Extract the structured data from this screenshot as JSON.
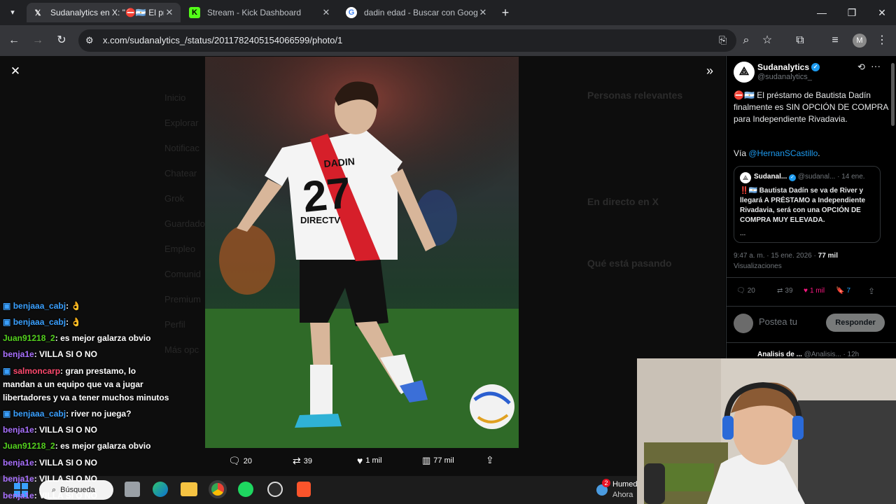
{
  "browser": {
    "tabs": [
      {
        "label": "Sudanalytics en X: \"⛔🇦🇷 El pré",
        "icon": "x-logo-icon"
      },
      {
        "label": "Stream - Kick Dashboard",
        "icon": "kick-logo-icon"
      },
      {
        "label": "dadin edad - Buscar con Google",
        "icon": "google-logo-icon"
      }
    ],
    "url": "x.com/sudanalytics_/status/2011782405154066599/photo/1",
    "profile_initial": "M"
  },
  "photo": {
    "alt": "River Plate player number 27 Dadín",
    "jersey_name": "DADIN",
    "jersey_number": "27",
    "sponsor": "DIRECTV"
  },
  "photo_actions": {
    "replies": "20",
    "reposts": "39",
    "likes": "1 mil",
    "views": "77 mil"
  },
  "tweet": {
    "author_name": "Sudanalytics",
    "author_handle": "@sudanalytics_",
    "text": "⛔🇦🇷 El préstamo de Bautista Dadín finalmente es SIN OPCIÓN DE COMPRA para Independiente Rivadavia.",
    "via_prefix": "Vía ",
    "via_mention": "@HernanSCastillo",
    "via_suffix": ".",
    "quote": {
      "author": "Sudanal...",
      "handle": "@sudanal...",
      "date": "· 14 ene.",
      "text": "‼️🇦🇷 Bautista Dadín se va de River y llegará A PRÉSTAMO a Independiente Rivadavia, será con una OPCIÓN DE COMPRA MUY ELEVADA.",
      "more": "..."
    },
    "timestamp": "9:47 a. m. · 15 ene. 2026 · ",
    "views_count": "77 mil",
    "views_label": "Visualizaciones",
    "stats": {
      "replies": "20",
      "reposts": "39",
      "likes": "1 mil",
      "bookmarks": "7"
    },
    "reply_placeholder": "Postea tu",
    "reply_button": "Responder",
    "next_author": "Analisis de ...",
    "next_handle": "@Analisis...",
    "next_time": "· 12h"
  },
  "background_sidebar": [
    "Inicio",
    "Explorar",
    "Notificac",
    "Chatear",
    "Grok",
    "Guardado",
    "Empleo",
    "Comunid",
    "Premium",
    "Perfil",
    "Más opc"
  ],
  "background_right": {
    "heading1": "Personas relevantes",
    "heading2": "En directo en X",
    "heading3": "Qué está pasando"
  },
  "chat": [
    {
      "user": "benjaaa_cabj",
      "color": "#3aa0ff",
      "text": ": 👌",
      "badge": true
    },
    {
      "user": "benjaaa_cabj",
      "color": "#3aa0ff",
      "text": ": 👌",
      "badge": true
    },
    {
      "user": "Juan91218_2",
      "color": "#54d21e",
      "text": ": es mejor galarza obvio",
      "badge": false
    },
    {
      "user": "benja1e",
      "color": "#a970ff",
      "text": ": VILLA SI O NO",
      "badge": false
    },
    {
      "user": "salmoncarp",
      "color": "#ff4a6e",
      "text": ": gran prestamo, lo",
      "badge": true
    },
    {
      "user": "",
      "color": "#ffffff",
      "text": "mandan a un equipo que va a jugar",
      "badge": false
    },
    {
      "user": "",
      "color": "#ffffff",
      "text": "libertadores y va a tener muchos minutos",
      "badge": false
    },
    {
      "user": "benjaaa_cabj",
      "color": "#3aa0ff",
      "text": ": river no juega?",
      "badge": true
    },
    {
      "user": "benja1e",
      "color": "#a970ff",
      "text": ": VILLA SI O NO",
      "badge": false
    },
    {
      "user": "Juan91218_2",
      "color": "#54d21e",
      "text": ": es mejor galarza obvio",
      "badge": false
    },
    {
      "user": "benja1e",
      "color": "#a970ff",
      "text": ": VILLA SI O NO",
      "badge": false
    },
    {
      "user": "benja1e",
      "color": "#a970ff",
      "text": ": VILLA SI O NO",
      "badge": false
    },
    {
      "user": "benja1e",
      "color": "#a970ff",
      "text": ": VILLA SI O NO",
      "badge": false
    }
  ],
  "taskbar": {
    "search": "Búsqueda",
    "weather_title": "Humed",
    "weather_sub": "Ahora",
    "notifications": "2"
  }
}
